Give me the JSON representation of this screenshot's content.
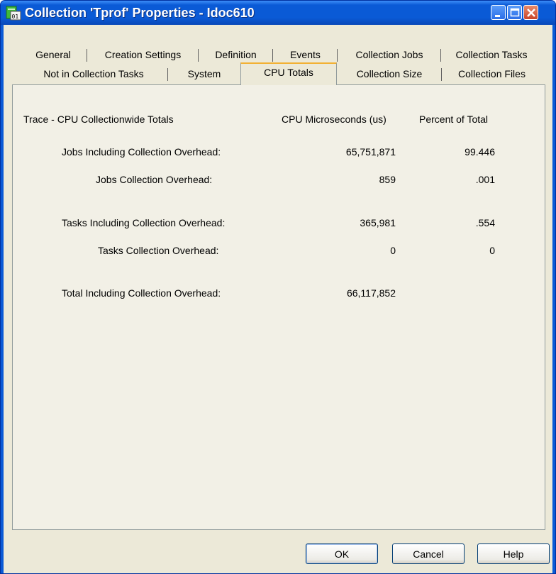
{
  "window": {
    "title": "Collection 'Tprof' Properties - Idoc610",
    "icon": "collection-app-icon",
    "controls": [
      "minimize-icon",
      "maximize-icon",
      "close-icon"
    ]
  },
  "tabs": {
    "row1": [
      "General",
      "Creation Settings",
      "Definition",
      "Events",
      "Collection Jobs",
      "Collection Tasks"
    ],
    "row2": [
      "Not in Collection Tasks",
      "System",
      "CPU Totals",
      "Collection Size",
      "Collection Files"
    ],
    "active": "CPU Totals"
  },
  "cpu_totals": {
    "section_title": "Trace - CPU Collectionwide Totals",
    "col_cpu": "CPU Microseconds (us)",
    "col_percent": "Percent of Total",
    "rows": [
      {
        "label": "Jobs Including Collection Overhead:",
        "cpu": "65,751,871",
        "percent": "99.446"
      },
      {
        "label": "Jobs Collection Overhead:",
        "cpu": "859",
        "percent": ".001"
      },
      {
        "label": "Tasks Including Collection Overhead:",
        "cpu": "365,981",
        "percent": ".554"
      },
      {
        "label": "Tasks Collection Overhead:",
        "cpu": "0",
        "percent": "0"
      },
      {
        "label": "Total Including Collection Overhead:",
        "cpu": "66,117,852",
        "percent": ""
      }
    ]
  },
  "buttons": {
    "ok": "OK",
    "cancel": "Cancel",
    "help": "Help"
  },
  "colors": {
    "titlebar": "#0a5ad6",
    "dialog_bg": "#ece9d8",
    "active_tab_accent": "#f2b134"
  }
}
